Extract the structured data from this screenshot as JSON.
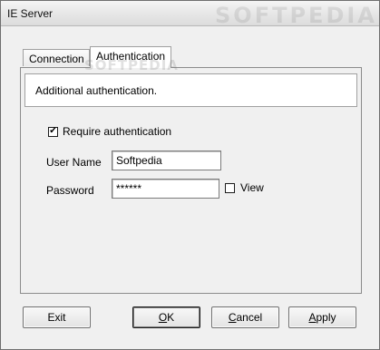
{
  "window": {
    "title": "IE Server",
    "watermark": "SOFTPEDIA"
  },
  "tabs": [
    {
      "label": "Connection",
      "active": false
    },
    {
      "label": "Authentication",
      "active": true
    }
  ],
  "tab_watermark": "SOFTPEDIA",
  "panel": {
    "info_text": "Additional authentication.",
    "require_auth": {
      "label": "Require authentication",
      "checked": true
    },
    "user_name": {
      "label": "User Name",
      "value": "Softpedia"
    },
    "password": {
      "label": "Password",
      "value": "******"
    },
    "view": {
      "label": "View",
      "checked": false
    }
  },
  "buttons": {
    "exit": "Exit",
    "ok": {
      "mnemonic": "O",
      "rest": "K"
    },
    "cancel": {
      "mnemonic": "C",
      "rest": "ancel"
    },
    "apply": {
      "mnemonic": "A",
      "rest": "pply"
    }
  },
  "icons": {
    "checkmark": "checkmark-icon"
  },
  "colors": {
    "window_bg": "#f0f0f0",
    "info_bg": "#ffffff",
    "border": "#8c8c8c"
  }
}
